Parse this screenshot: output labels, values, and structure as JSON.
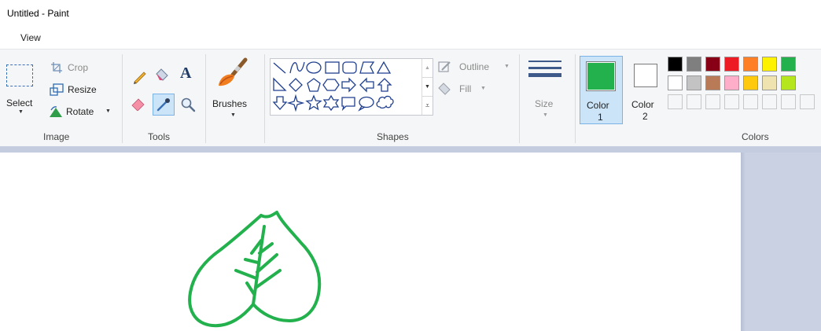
{
  "window": {
    "title": "Untitled - Paint"
  },
  "menu": {
    "view": "View"
  },
  "image_group": {
    "label": "Image",
    "select": "Select",
    "crop": "Crop",
    "resize": "Resize",
    "rotate": "Rotate"
  },
  "tools_group": {
    "label": "Tools"
  },
  "brushes": {
    "label": "Brushes"
  },
  "shapes_group": {
    "label": "Shapes",
    "outline": "Outline",
    "fill": "Fill"
  },
  "size": {
    "label": "Size"
  },
  "colors_group": {
    "label": "Colors",
    "color1_label": "Color",
    "color1_num": "1",
    "color2_label": "Color",
    "color2_num": "2",
    "color1_value": "#22b14c",
    "color2_value": "#ffffff",
    "palette_row1": [
      "#000000",
      "#7f7f7f",
      "#880015",
      "#ed1c24",
      "#ff7f27",
      "#fff200",
      "#22b14c"
    ],
    "palette_row2": [
      "#ffffff",
      "#c3c3c3",
      "#b97a57",
      "#ffaec9",
      "#ffc90e",
      "#efe4b0",
      "#b5e61d"
    ]
  },
  "canvas": {
    "stroke_color": "#22b14c"
  }
}
